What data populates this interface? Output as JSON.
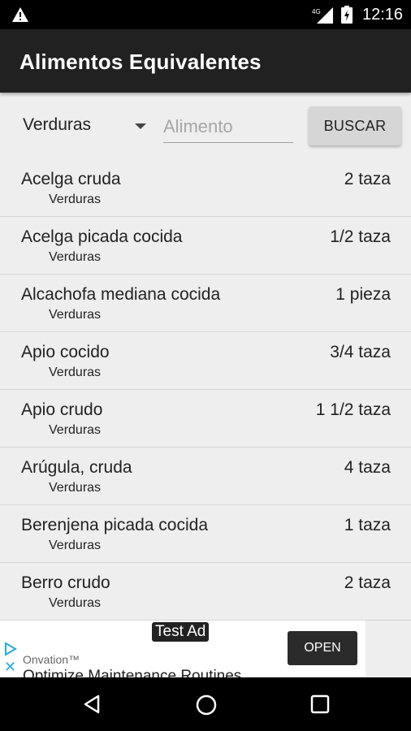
{
  "status_bar": {
    "network": "4G",
    "time": "12:16",
    "icons": [
      "warning-icon",
      "signal-icon",
      "battery-icon"
    ]
  },
  "app_bar": {
    "title": "Alimentos Equivalentes"
  },
  "search": {
    "category_selected": "Verduras",
    "input_value": "",
    "input_placeholder": "Alimento",
    "button_label": "BUSCAR"
  },
  "items": [
    {
      "name": "Acelga cruda",
      "category": "Verduras",
      "quantity": "2 taza"
    },
    {
      "name": "Acelga picada cocida",
      "category": "Verduras",
      "quantity": "1/2 taza"
    },
    {
      "name": "Alcachofa mediana cocida",
      "category": "Verduras",
      "quantity": "1 pieza"
    },
    {
      "name": "Apio cocido",
      "category": "Verduras",
      "quantity": "3/4 taza"
    },
    {
      "name": "Apio crudo",
      "category": "Verduras",
      "quantity": "1 1/2 taza"
    },
    {
      "name": "Arúgula, cruda",
      "category": "Verduras",
      "quantity": "4 taza"
    },
    {
      "name": "Berenjena picada cocida",
      "category": "Verduras",
      "quantity": "1 taza"
    },
    {
      "name": "Berro crudo",
      "category": "Verduras",
      "quantity": "2 taza"
    }
  ],
  "ad": {
    "badge": "Test Ad",
    "advertiser": "Onvation™",
    "headline": "Optimize Maintenance Routines",
    "cta": "OPEN",
    "accent_color": "#29a9e0"
  },
  "colors": {
    "app_bar": "#212121",
    "background": "#eeeeee",
    "divider": "#d7d7d7"
  }
}
